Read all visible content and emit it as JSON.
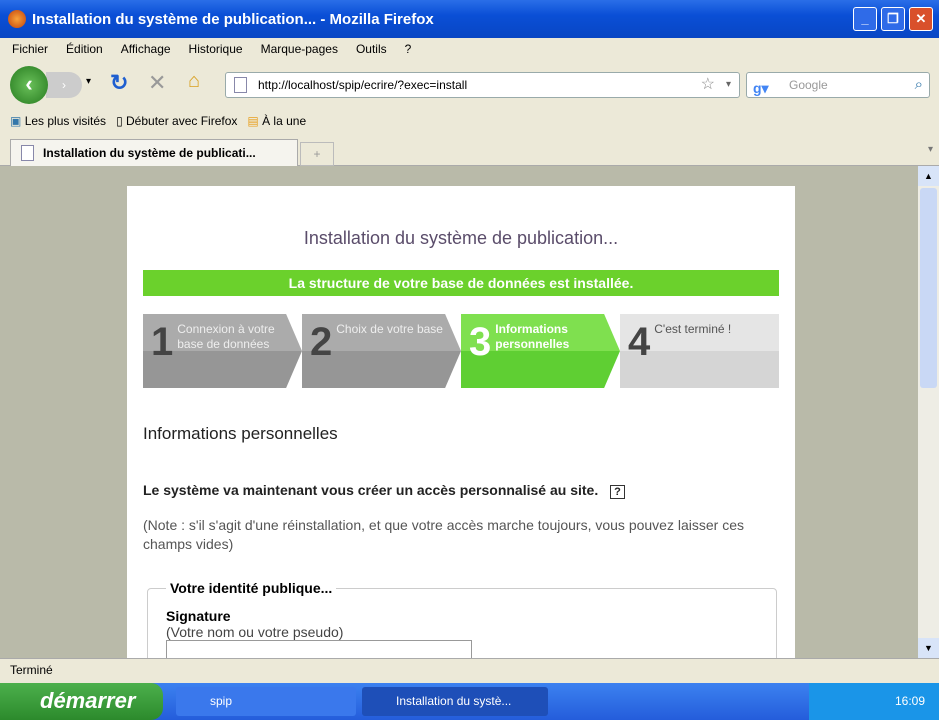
{
  "window": {
    "title": "Installation du système de publication... - Mozilla Firefox",
    "minimize": "_",
    "restore": "❐",
    "close": "✕"
  },
  "menu": [
    "Fichier",
    "Édition",
    "Affichage",
    "Historique",
    "Marque-pages",
    "Outils",
    "?"
  ],
  "nav": {
    "url": "http://localhost/spip/ecrire/?exec=install",
    "search_placeholder": "Google"
  },
  "bookmarks": [
    "Les plus visités",
    "Débuter avec Firefox",
    "À la une"
  ],
  "tab": {
    "label": "Installation du système de publicati...",
    "new_tab": "+"
  },
  "page": {
    "title": "Installation du système de publication...",
    "banner": "La structure de votre base de données est installée.",
    "steps": [
      {
        "n": "1",
        "label": "Connexion à votre base de données"
      },
      {
        "n": "2",
        "label": "Choix de votre base"
      },
      {
        "n": "3",
        "label": "Informations personnelles"
      },
      {
        "n": "4",
        "label": "C'est terminé !"
      }
    ],
    "section_title": "Informations personnelles",
    "intro": "Le système va maintenant vous créer un accès personnalisé au site.",
    "help": "?",
    "note": "(Note : s'il s'agit d'une réinstallation, et que votre accès marche toujours, vous pouvez laisser ces champs vides)",
    "fieldset_legend": "Votre identité publique...",
    "signature_label": "Signature",
    "signature_hint": "(Votre nom ou votre pseudo)"
  },
  "status": "Terminé",
  "taskbar": {
    "start": "démarrer",
    "items": [
      "spip",
      "Installation du systè..."
    ],
    "clock": "16:09"
  }
}
